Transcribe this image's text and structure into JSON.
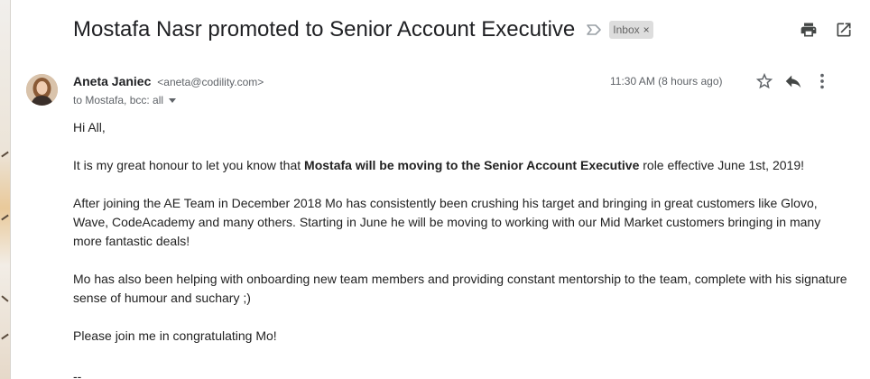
{
  "email": {
    "subject": "Mostafa Nasr promoted to Senior Account Executive",
    "label": "Inbox",
    "label_close": "×",
    "sender_name": "Aneta Janiec",
    "sender_email": "<aneta@codility.com>",
    "recipients": "to Mostafa, bcc: all",
    "timestamp": "11:30 AM (8 hours ago)",
    "body": {
      "greeting": "Hi All,",
      "p1_before": "It is my great honour to let you know that ",
      "p1_bold": "Mostafa will be moving to the Senior Account Executive",
      "p1_after": " role effective June 1st, 2019!",
      "p2": "After joining the AE Team in December 2018 Mo has consistently been crushing his target and bringing in great customers like Glovo, Wave, CodeAcademy and many others. Starting in June he will be moving to working with our Mid Market customers bringing in many more fantastic deals!",
      "p3": "Mo has also been helping with onboarding new team members and providing constant mentorship to the team, complete with his signature sense of humour and suchary ;)",
      "p4": "Please join me in congratulating Mo!",
      "trailing": "--"
    }
  },
  "icons": {
    "important": "important-marker-icon",
    "print": "print-icon",
    "open_new_window": "open-in-new-window-icon",
    "star": "star-icon",
    "reply": "reply-icon",
    "more": "more-vertical-icon",
    "avatar": "avatar"
  },
  "colors": {
    "text": "#202124",
    "secondary_text": "#5f6368",
    "label_bg": "#dddddd",
    "icon": "#5f6368"
  }
}
